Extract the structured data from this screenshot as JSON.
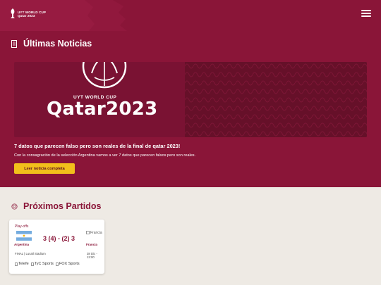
{
  "header": {
    "logo_line1": "UYT WORLD CUP",
    "logo_line2": "Qatar 2023",
    "menu_icon": "hamburger-menu-icon"
  },
  "news": {
    "section_title": "Últimas Noticias",
    "section_icon": "news-icon",
    "banner": {
      "subtitle": "UYT WORLD CUP",
      "brand": "Qatar2023"
    },
    "title": "7 datos que parecen falso pero son reales de la final de qatar 2023!",
    "description": "Con la consagración de la selección Argentina vamos a ver 7 datos que parecen falsos pero son reales.",
    "button_label": "Leer noticia completa"
  },
  "matches": {
    "section_title": "Próximos Partidos",
    "section_icon": "ball-icon",
    "items": [
      {
        "stage": "Play-offs",
        "home_team": "Argentina",
        "away_team": "Francia",
        "away_flag_alt": "Francia",
        "score": "3 (4) - (2) 3",
        "info": "FINAL | Lusail Stadium",
        "date": "38 Dic - 12:00",
        "broadcasters": [
          "Telefe",
          "TyC Sports",
          "FOX Sports"
        ]
      }
    ]
  },
  "colors": {
    "primary": "#8a1538",
    "accent": "#f2c01b",
    "background": "#eeeae4"
  }
}
